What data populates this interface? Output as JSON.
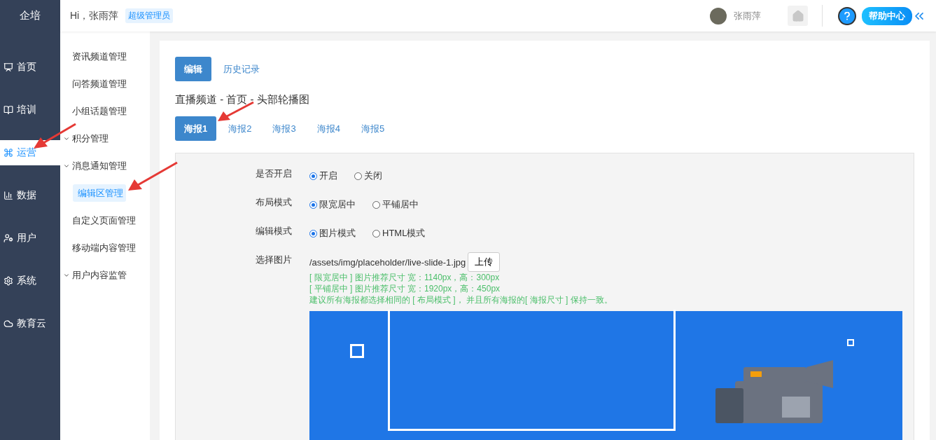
{
  "brand": "企培",
  "header": {
    "greeting": "Hi，张雨萍",
    "role_badge": "超级管理员",
    "user_name": "张雨萍",
    "help_label": "帮助中心"
  },
  "nav": [
    {
      "label": "首页",
      "selected": false
    },
    {
      "label": "培训",
      "selected": false
    },
    {
      "label": "运营",
      "selected": true
    },
    {
      "label": "数据",
      "selected": false
    },
    {
      "label": "用户",
      "selected": false
    },
    {
      "label": "系统",
      "selected": false
    },
    {
      "label": "教育云",
      "selected": false
    }
  ],
  "submenu": [
    {
      "label": "资讯频道管理",
      "kind": "link",
      "selected": false
    },
    {
      "label": "问答频道管理",
      "kind": "link",
      "selected": false
    },
    {
      "label": "小组话题管理",
      "kind": "link",
      "selected": false
    },
    {
      "label": "积分管理",
      "kind": "group",
      "selected": false
    },
    {
      "label": "消息通知管理",
      "kind": "group",
      "selected": false
    },
    {
      "label": "编辑区管理",
      "kind": "link",
      "selected": true
    },
    {
      "label": "自定义页面管理",
      "kind": "link",
      "selected": false
    },
    {
      "label": "移动端内容管理",
      "kind": "link",
      "selected": false
    },
    {
      "label": "用户内容监管",
      "kind": "group",
      "selected": false
    }
  ],
  "top_tabs": [
    {
      "label": "编辑",
      "selected": true
    },
    {
      "label": "历史记录",
      "selected": false
    }
  ],
  "breadcrumb": "直播频道 - 首页 - 头部轮播图",
  "poster_tabs": [
    {
      "label": "海报1",
      "selected": true
    },
    {
      "label": "海报2",
      "selected": false
    },
    {
      "label": "海报3",
      "selected": false
    },
    {
      "label": "海报4",
      "selected": false
    },
    {
      "label": "海报5",
      "selected": false
    }
  ],
  "form": [
    {
      "kind": "radio",
      "label": "是否开启",
      "options": [
        {
          "label": "开启",
          "selected": true
        },
        {
          "label": "关闭",
          "selected": false
        }
      ]
    },
    {
      "kind": "radio",
      "label": "布局模式",
      "options": [
        {
          "label": "限宽居中",
          "selected": true
        },
        {
          "label": "平铺居中",
          "selected": false
        }
      ]
    },
    {
      "kind": "radio",
      "label": "编辑模式",
      "options": [
        {
          "label": "图片模式",
          "selected": true
        },
        {
          "label": "HTML模式",
          "selected": false
        }
      ]
    },
    {
      "kind": "file",
      "label": "选择图片",
      "value": "/assets/img/placeholder/live-slide-1.jpg",
      "button": "上传",
      "hints": [
        "[ 限宽居中 ] 图片推荐尺寸 宽：1140px，高：300px",
        "[ 平铺居中 ] 图片推荐尺寸 宽：1920px，高：450px",
        "建议所有海报都选择相同的 [ 布局模式 ]， 并且所有海报的[ 海报尺寸 ] 保持一致。"
      ]
    }
  ]
}
